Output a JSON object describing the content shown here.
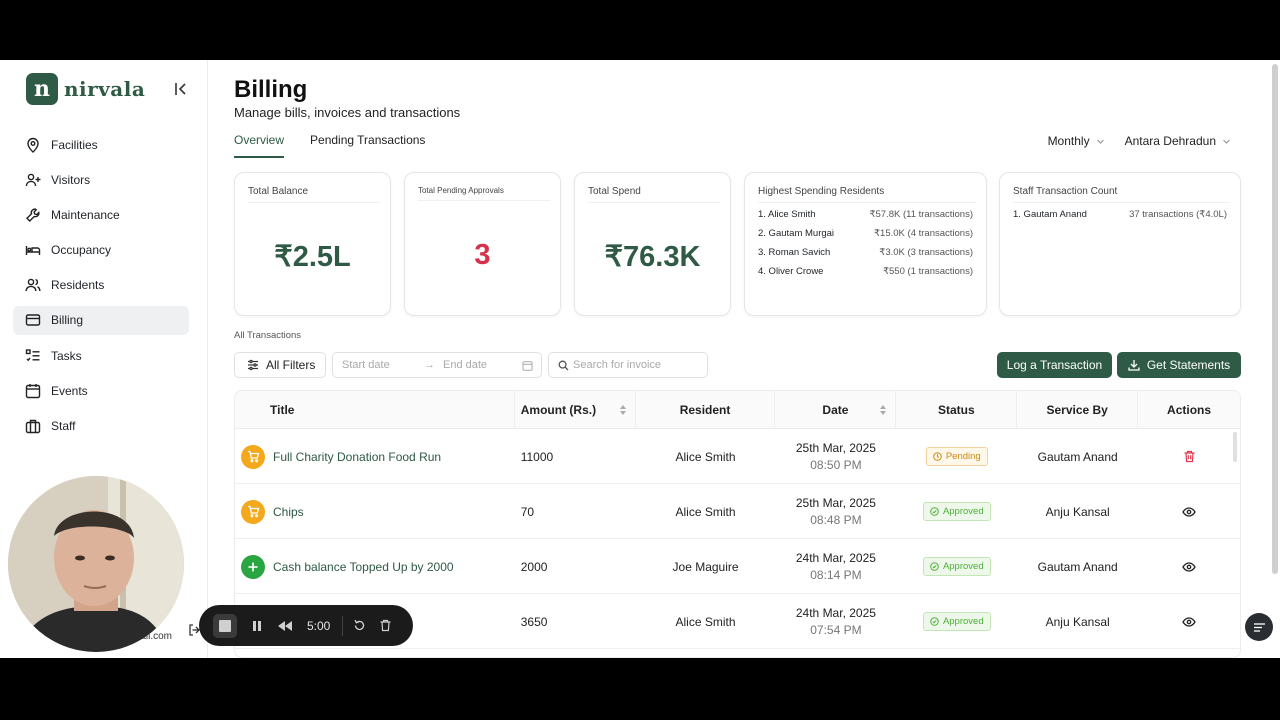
{
  "brand": {
    "name": "nirvala",
    "mark": "n"
  },
  "sidebar": {
    "items": [
      {
        "label": "Facilities",
        "icon": "map-pin-icon"
      },
      {
        "label": "Visitors",
        "icon": "user-plus-icon"
      },
      {
        "label": "Maintenance",
        "icon": "wrench-icon"
      },
      {
        "label": "Occupancy",
        "icon": "bed-icon"
      },
      {
        "label": "Residents",
        "icon": "users-icon"
      },
      {
        "label": "Billing",
        "icon": "credit-card-icon",
        "active": true
      },
      {
        "label": "Tasks",
        "icon": "list-checks-icon"
      },
      {
        "label": "Events",
        "icon": "calendar-icon"
      },
      {
        "label": "Staff",
        "icon": "briefcase-icon"
      }
    ],
    "user_email_fragment": "mail.com"
  },
  "header": {
    "title": "Billing",
    "subtitle": "Manage bills, invoices and transactions",
    "tabs": [
      "Overview",
      "Pending Transactions"
    ],
    "period": "Monthly",
    "facility": "Antara Dehradun"
  },
  "cards": {
    "total_balance": {
      "label": "Total Balance",
      "value": "₹2.5L"
    },
    "pending_approvals": {
      "label": "Total Pending Approvals",
      "value": "3"
    },
    "total_spend": {
      "label": "Total Spend",
      "value": "₹76.3K"
    },
    "highest_spending": {
      "label": "Highest Spending Residents",
      "rows": [
        {
          "name": "1. Alice Smith",
          "value": "₹57.8K (11 transactions)"
        },
        {
          "name": "2. Gautam Murgai",
          "value": "₹15.0K (4 transactions)"
        },
        {
          "name": "3. Roman Savich",
          "value": "₹3.0K (3 transactions)"
        },
        {
          "name": "4. Oliver Crowe",
          "value": "₹550 (1 transactions)"
        }
      ]
    },
    "staff_count": {
      "label": "Staff Transaction Count",
      "rows": [
        {
          "name": "1. Gautam Anand",
          "value": "37 transactions (₹4.0L)"
        }
      ]
    }
  },
  "transactions": {
    "section_label": "All Transactions",
    "filters_label": "All Filters",
    "start_placeholder": "Start date",
    "end_placeholder": "End date",
    "search_placeholder": "Search for invoice",
    "log_button": "Log a Transaction",
    "statements_button": "Get Statements",
    "columns": [
      "Title",
      "Amount (Rs.)",
      "Resident",
      "Date",
      "Status",
      "Service By",
      "Actions"
    ],
    "rows": [
      {
        "title": "Full Charity Donation Food Run",
        "amount": "11000",
        "resident": "Alice Smith",
        "date": "25th Mar, 2025",
        "time": "08:50 PM",
        "status": "Pending",
        "service_by": "Gautam Anand",
        "icon": "cart-icon",
        "action": "delete-icon"
      },
      {
        "title": "Chips",
        "amount": "70",
        "resident": "Alice Smith",
        "date": "25th Mar, 2025",
        "time": "08:48 PM",
        "status": "Approved",
        "service_by": "Anju Kansal",
        "icon": "cart-icon",
        "action": "view-icon"
      },
      {
        "title": "Cash balance Topped Up by 2000",
        "amount": "2000",
        "resident": "Joe Maguire",
        "date": "24th Mar, 2025",
        "time": "08:14 PM",
        "status": "Approved",
        "service_by": "Gautam Anand",
        "icon": "plus-icon",
        "action": "view-icon"
      },
      {
        "title": "",
        "amount": "3650",
        "resident": "Alice Smith",
        "date": "24th Mar, 2025",
        "time": "07:54 PM",
        "status": "Approved",
        "service_by": "Anju Kansal",
        "icon": "cart-icon",
        "action": "view-icon"
      }
    ]
  },
  "recorder": {
    "timer": "5:00"
  },
  "colors": {
    "brand": "#2f5a45",
    "pending": "#d08a17",
    "approved": "#4caf36",
    "danger": "#d6304a"
  }
}
